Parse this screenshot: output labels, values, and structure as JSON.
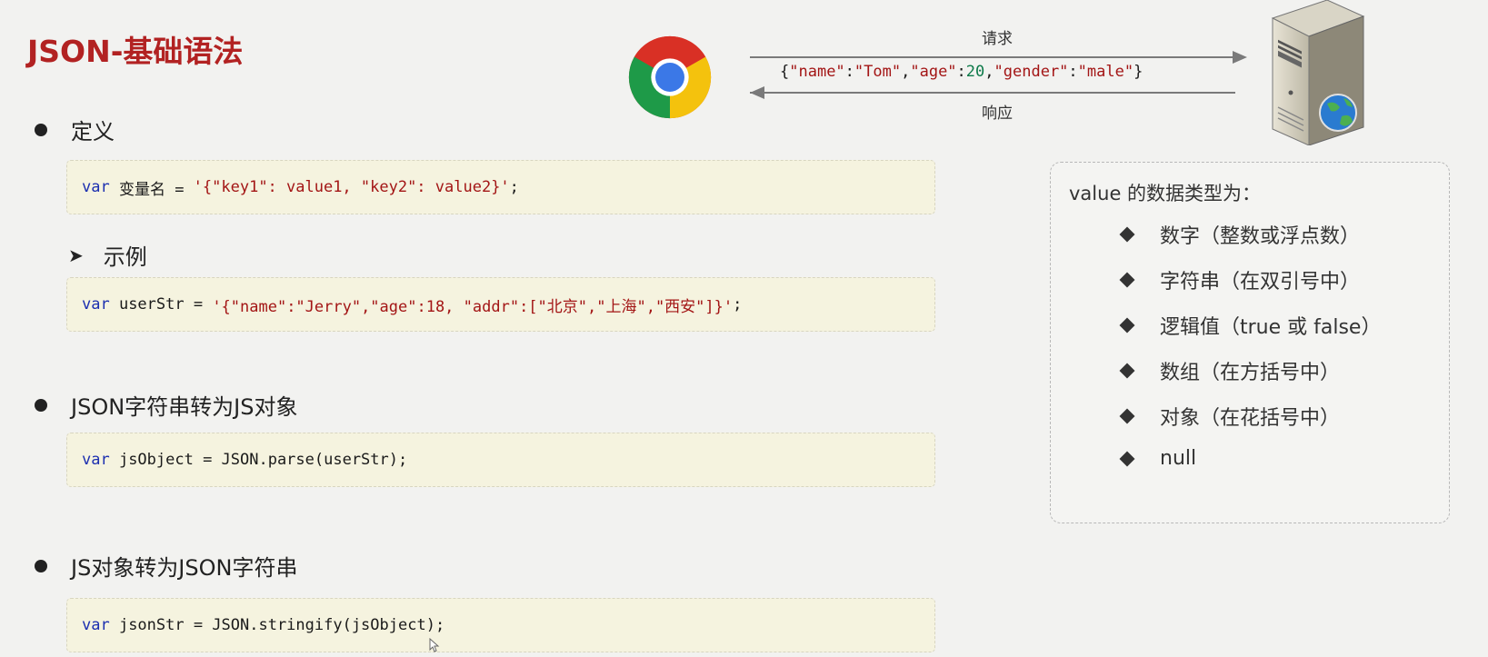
{
  "title": "JSON-基础语法",
  "definition": {
    "label": "定义",
    "code": {
      "kw": "var",
      "rest": " 变量名 = ",
      "str": "'{\"key1\": value1, \"key2\": value2}'",
      "end": ";"
    }
  },
  "example": {
    "label": "示例",
    "code": {
      "kw": "var",
      "rest": " userStr = ",
      "str": "'{\"name\":\"Jerry\",\"age\":18, \"addr\":[\"北京\",\"上海\",\"西安\"]}'",
      "end": ";"
    }
  },
  "parse": {
    "label": "JSON字符串转为JS对象",
    "code": {
      "kw": "var",
      "rest": " jsObject = JSON.parse(userStr);"
    }
  },
  "stringify": {
    "label": "JS对象转为JSON字符串",
    "code": {
      "kw": "var",
      "rest": " jsonStr = JSON.stringify(jsObject);"
    }
  },
  "diagram": {
    "request_label": "请求",
    "response_label": "响应",
    "json_parts": {
      "p1": "{",
      "k1": "\"name\"",
      "c1": ":",
      "v1": "\"Tom\"",
      "c2": ",",
      "k2": "\"age\"",
      "c3": ":",
      "v2": "20",
      "c4": ",",
      "k3": "\"gender\"",
      "c5": ":",
      "v3": "\"male\"",
      "p2": "}"
    }
  },
  "value_types": {
    "heading": "value 的数据类型为：",
    "items": [
      "数字（整数或浮点数）",
      "字符串（在双引号中）",
      "逻辑值（true 或 false）",
      "数组（在方括号中）",
      "对象（在花括号中）",
      "null"
    ]
  },
  "colors": {
    "title": "#b22222",
    "keyword": "#1c2fb0",
    "string": "#a31515",
    "number": "#0e7a4a",
    "code_bg": "#f5f3df"
  },
  "icons": {
    "browser": "chrome-icon",
    "server": "server-icon",
    "globe": "globe-icon"
  }
}
